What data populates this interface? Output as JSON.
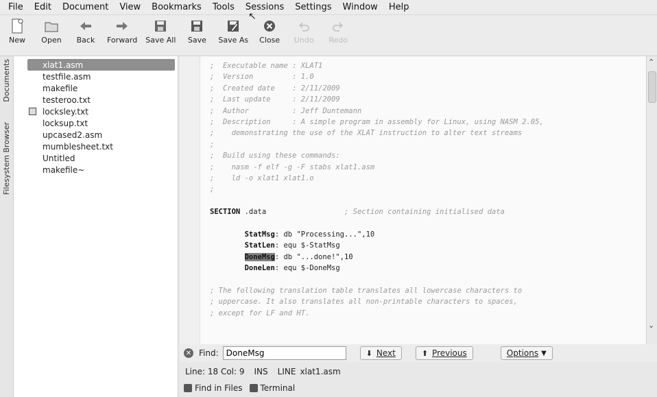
{
  "menubar": {
    "items": [
      {
        "key": "file",
        "label": "File"
      },
      {
        "key": "edit",
        "label": "Edit"
      },
      {
        "key": "document",
        "label": "Document"
      },
      {
        "key": "view",
        "label": "View"
      },
      {
        "key": "bookmarks",
        "label": "Bookmarks"
      },
      {
        "key": "tools",
        "label": "Tools"
      },
      {
        "key": "sessions",
        "label": "Sessions"
      },
      {
        "key": "settings",
        "label": "Settings"
      },
      {
        "key": "window",
        "label": "Window"
      },
      {
        "key": "help",
        "label": "Help"
      }
    ]
  },
  "toolbar": {
    "new": "New",
    "open": "Open",
    "back": "Back",
    "forward": "Forward",
    "save_all": "Save All",
    "save": "Save",
    "save_as": "Save As",
    "close": "Close",
    "undo": "Undo",
    "redo": "Redo"
  },
  "sidetabs": {
    "documents": "Documents",
    "filesystem": "Filesystem Browser"
  },
  "documents": [
    {
      "name": "xlat1.asm",
      "selected": true,
      "icon": ""
    },
    {
      "name": "testfile.asm",
      "selected": false,
      "icon": ""
    },
    {
      "name": "makefile",
      "selected": false,
      "icon": ""
    },
    {
      "name": "testeroo.txt",
      "selected": false,
      "icon": ""
    },
    {
      "name": "locksley.txt",
      "selected": false,
      "icon": "floppy-icon"
    },
    {
      "name": "locksup.txt",
      "selected": false,
      "icon": ""
    },
    {
      "name": "upcased2.asm",
      "selected": false,
      "icon": ""
    },
    {
      "name": "mumblesheet.txt",
      "selected": false,
      "icon": ""
    },
    {
      "name": "Untitled",
      "selected": false,
      "icon": ""
    },
    {
      "name": "makefile~",
      "selected": false,
      "icon": ""
    }
  ],
  "editor": {
    "lines": [
      {
        "c": ";  Executable name : XLAT1",
        "t": "cm"
      },
      {
        "c": ";  Version         : 1.0",
        "t": "cm"
      },
      {
        "c": ";  Created date    : 2/11/2009",
        "t": "cm"
      },
      {
        "c": ";  Last update     : 2/11/2009",
        "t": "cm"
      },
      {
        "c": ";  Author          : Jeff Duntemann",
        "t": "cm"
      },
      {
        "c": ";  Description     : A simple program in assembly for Linux, using NASM 2.05,",
        "t": "cm"
      },
      {
        "c": ";    demonstrating the use of the XLAT instruction to alter text streams",
        "t": "cm"
      },
      {
        "c": ";",
        "t": "cm"
      },
      {
        "c": ";  Build using these commands:",
        "t": "cm"
      },
      {
        "c": ";    nasm -f elf -g -F stabs xlat1.asm",
        "t": "cm"
      },
      {
        "c": ";    ld -o xlat1 xlat1.o",
        "t": "cm"
      },
      {
        "c": ";",
        "t": "cm"
      },
      {
        "c": "",
        "t": "cm"
      },
      {
        "c": "SECTION .data                  ; Section containing initialised data",
        "t": "section"
      },
      {
        "c": "",
        "t": "cm"
      },
      {
        "c": "        StatMsg: db \"Processing...\",10",
        "t": "code1"
      },
      {
        "c": "        StatLen: equ $-StatMsg",
        "t": "code2"
      },
      {
        "c": "        DoneMsg: db \"...done!\",10",
        "t": "code3"
      },
      {
        "c": "        DoneLen: equ $-DoneMsg",
        "t": "code4"
      },
      {
        "c": "",
        "t": "cm"
      },
      {
        "c": "; The following translation table translates all lowercase characters to",
        "t": "cm"
      },
      {
        "c": "; uppercase. It also translates all non-printable characters to spaces,",
        "t": "cm"
      },
      {
        "c": "; except for LF and HT.",
        "t": "cm"
      }
    ]
  },
  "findbar": {
    "label": "Find:",
    "value": "DoneMsg",
    "next": "Next",
    "previous": "Previous",
    "options": "Options"
  },
  "status": {
    "position": "Line: 18 Col: 9",
    "mode": "INS",
    "line_mode": "LINE",
    "filename": "xlat1.asm"
  },
  "bottombar": {
    "find_in_files": "Find in Files",
    "terminal": "Terminal"
  }
}
